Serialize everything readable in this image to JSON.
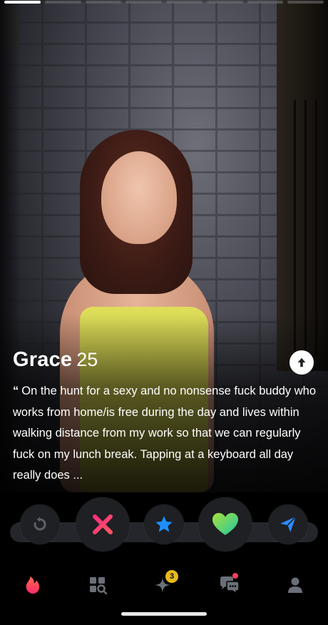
{
  "profile": {
    "name": "Grace",
    "age": "25",
    "quote_mark": "“",
    "bio": "On the hunt for a sexy and no nonsense fuck buddy who works from home/is free during the day and lives within walking distance from my work so that we can regularly fuck on my lunch break. Tapping at a keyboard all day really does ..."
  },
  "story": {
    "total": 8,
    "active_index": 0
  },
  "actions": [
    {
      "name": "rewind-icon",
      "color": "#c7a54a"
    },
    {
      "name": "nope-icon",
      "color": "#fd3f6f"
    },
    {
      "name": "super-like-icon",
      "color": "#2aa7ff"
    },
    {
      "name": "like-icon",
      "color": "#4fd58f"
    },
    {
      "name": "boost-icon",
      "color": "#3b8dff"
    }
  ],
  "nav": {
    "items": [
      "flame-icon",
      "explore-icon",
      "sparkles-icon",
      "chat-icon",
      "profile-icon"
    ],
    "sparkles_badge": "3"
  },
  "colors": {
    "accent": "#fd3f5b"
  }
}
